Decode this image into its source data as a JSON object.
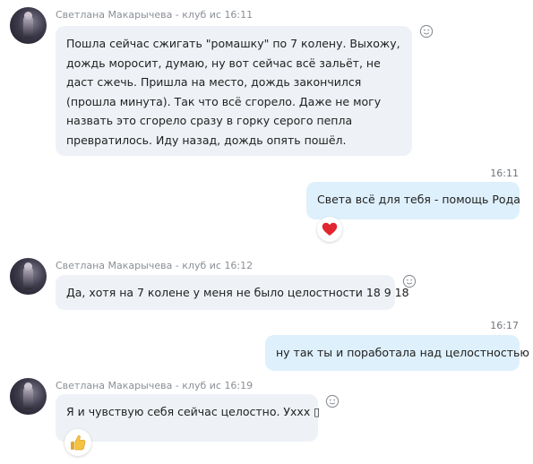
{
  "messages": [
    {
      "sender": "Светлана Макарычева - клуб ис",
      "time": "16:11",
      "text": "Пошла сейчас сжигать \"ромашку\" по 7 колену. Выхожу, дождь моросит, думаю, ну вот сейчас всё зальёт, не даст сжечь. Пришла на место, дождь закончился (прошла минута). Так что всё сгорело. Даже не могу назвать это сгорело сразу в горку серого пепла превратилось. Иду назад, дождь опять пошёл."
    },
    {
      "time": "16:11",
      "text": "Света всё для тебя - помощь Рода",
      "reaction": "heart-icon"
    },
    {
      "sender": "Светлана Макарычева - клуб ис",
      "time": "16:12",
      "text": "Да, хотя на 7 колене у меня не было целостности 18 9 18"
    },
    {
      "time": "16:17",
      "text": "ну так ты и поработала над целостностью"
    },
    {
      "sender": "Светлана Макарычева - клуб ис",
      "time": "16:19",
      "text": "Я и чувствую себя сейчас целостно. Уххх ▯",
      "reaction": "thumbs-up-icon"
    }
  ],
  "colors": {
    "incoming_bubble": "#eef2f6",
    "outgoing_bubble": "#def0fc",
    "heart": "#e0262f",
    "thumbs_up": "#f5c342",
    "meta_text": "#8a8f96"
  }
}
